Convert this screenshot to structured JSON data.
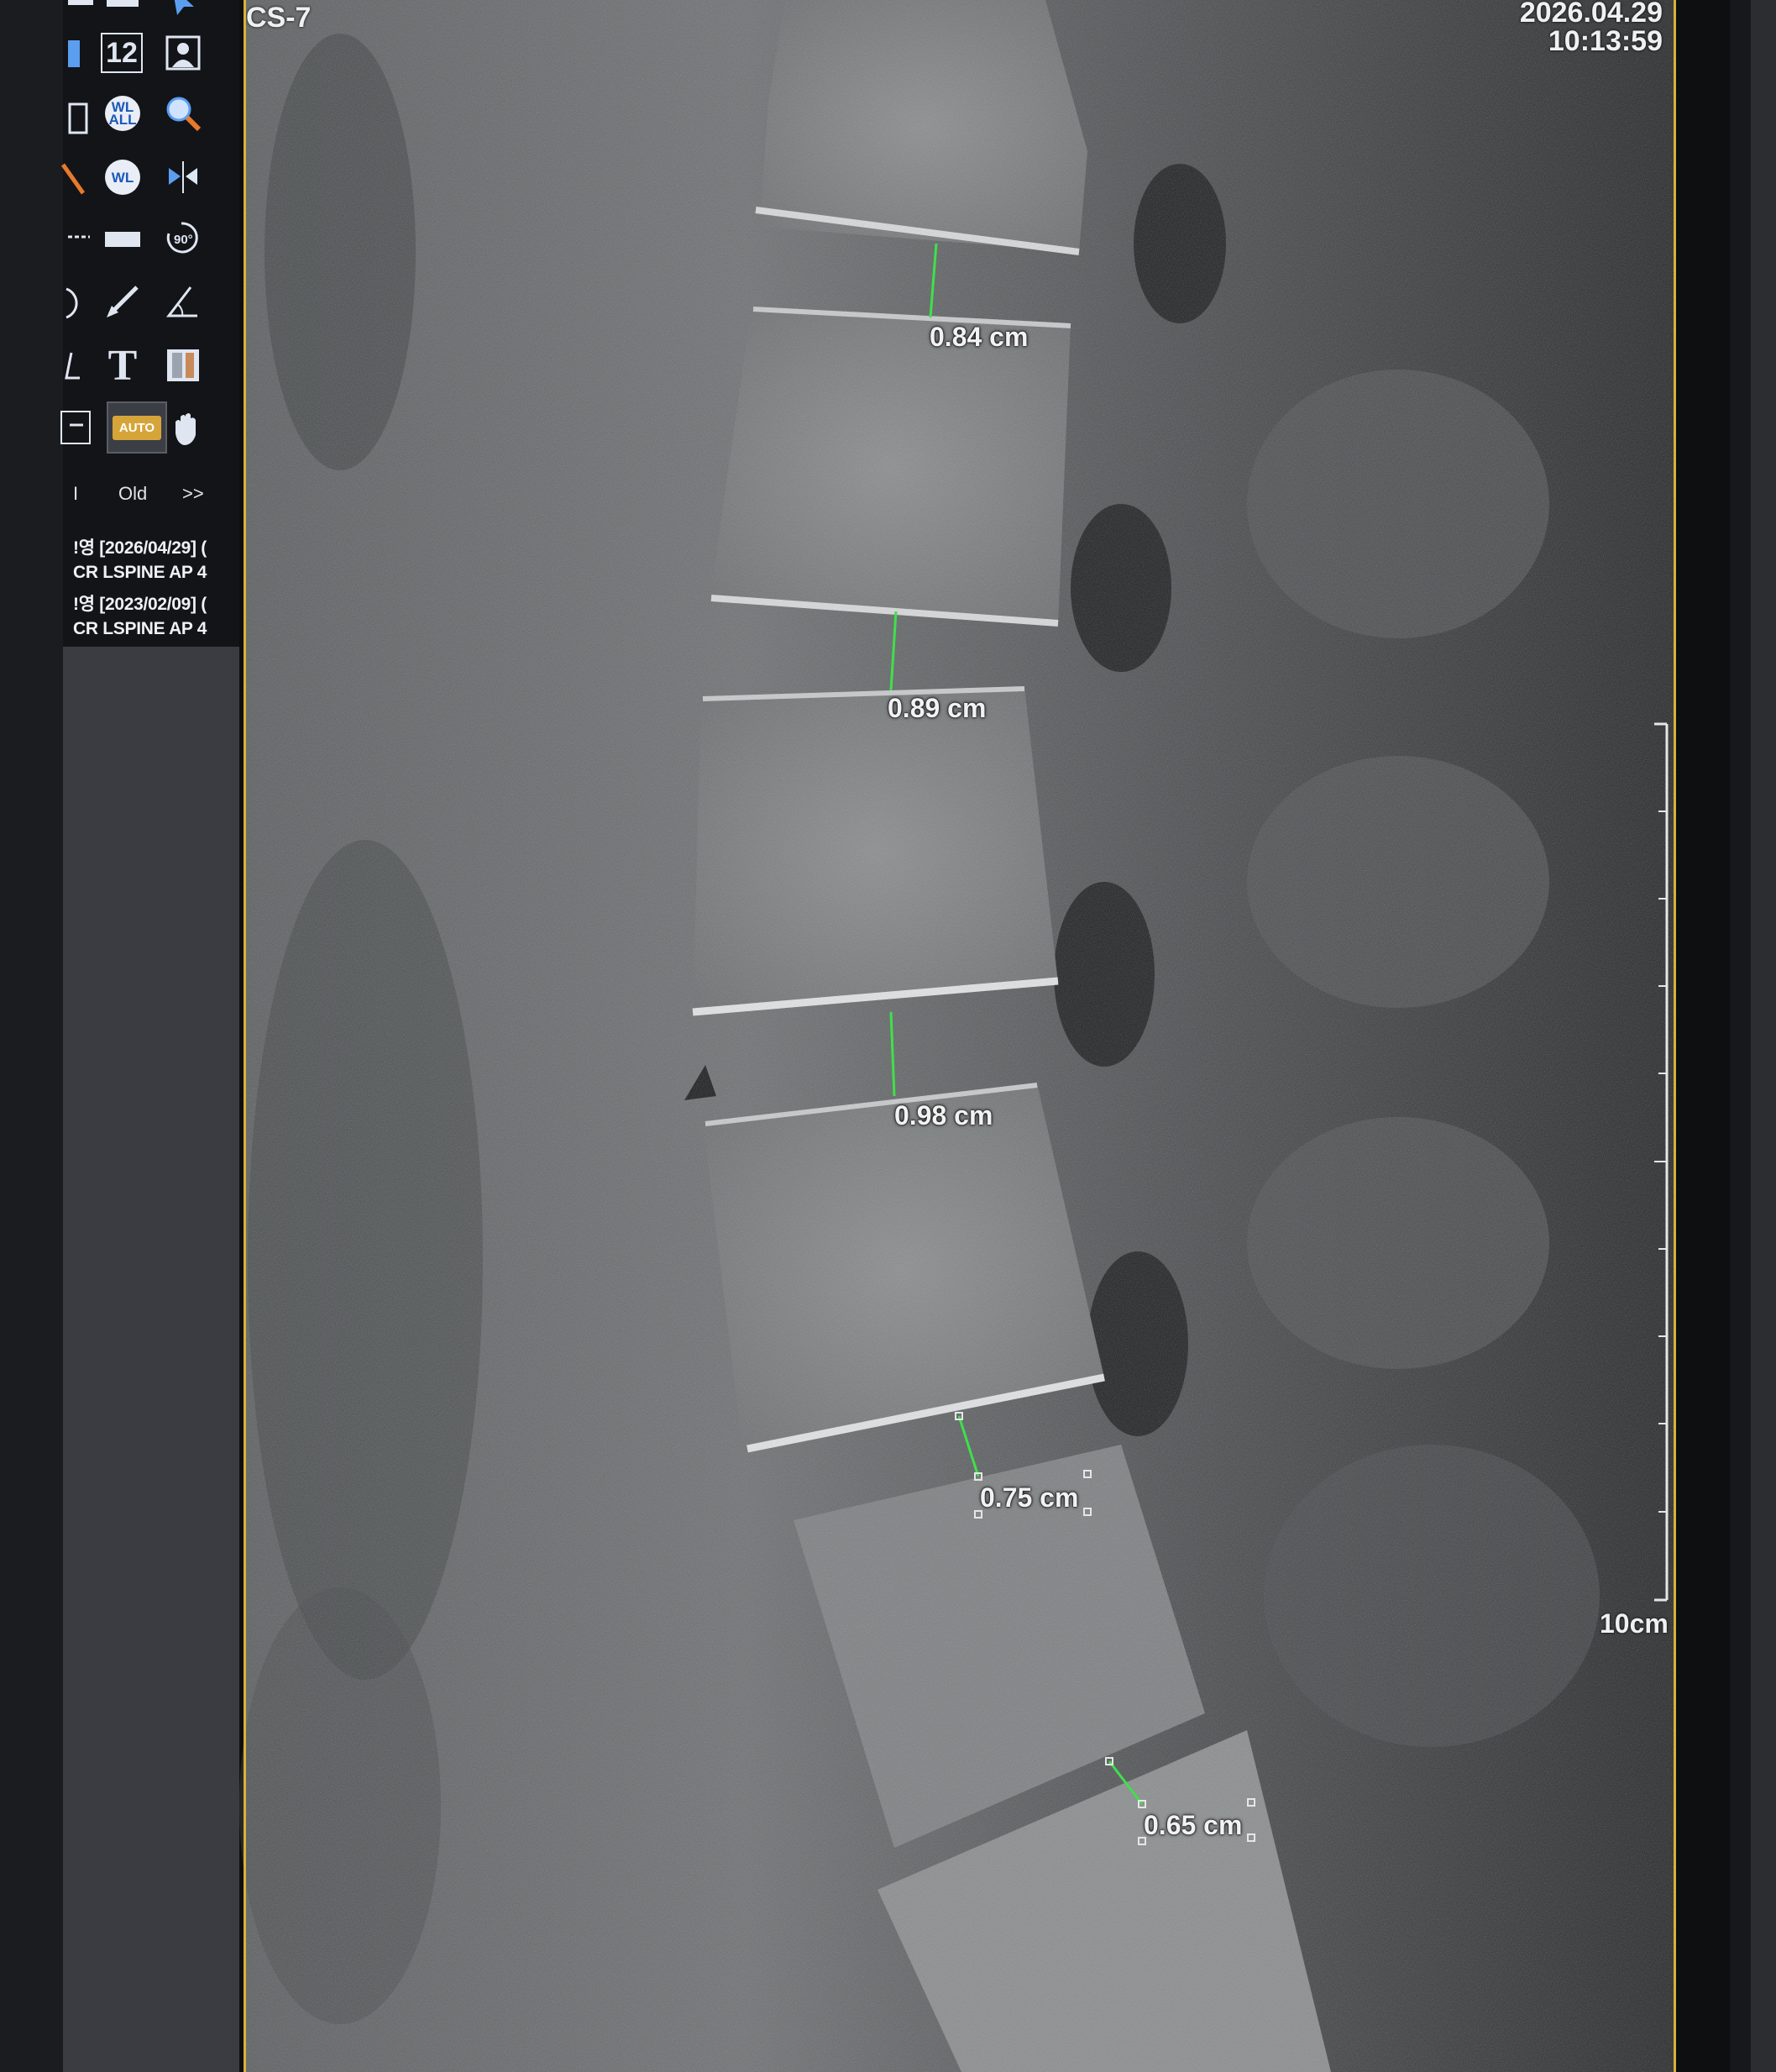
{
  "header": {
    "study_label": "CS-7",
    "date": "2026.04.29",
    "time": "10:13:59"
  },
  "toolbar": {
    "icons": [
      "series-icon",
      "layout-1-2-icon",
      "portrait-icon",
      "hanging-icon",
      "wl-all-icon",
      "zoom-icon",
      "wl-icon",
      "flip-icon",
      "ruler-icon",
      "rotate-90-icon",
      "ellipse-icon",
      "line-measure-icon",
      "angle-icon",
      "text-tool-icon",
      "compare-icon",
      "cursor-icon",
      "auto-icon",
      "pan-hand-icon"
    ],
    "layout_label": "12",
    "wl_all_label_top": "WL",
    "wl_all_label_bottom": "ALL",
    "wl_label": "WL",
    "rotate_label": "90°",
    "text_tool_label": "T",
    "auto_label": "AUTO"
  },
  "study_nav": {
    "old_label": "Old",
    "next_label": ">>",
    "prefix_label": "I"
  },
  "studies": [
    {
      "date_line": "!영 [2026/04/29] (",
      "desc": "CR LSPINE AP 4"
    },
    {
      "date_line": "!영 [2023/02/09] (",
      "desc": "CR LSPINE AP 4"
    }
  ],
  "measurements": [
    {
      "label": "0.84 cm",
      "value": 0.84,
      "unit": "cm"
    },
    {
      "label": "0.89 cm",
      "value": 0.89,
      "unit": "cm"
    },
    {
      "label": "0.98 cm",
      "value": 0.98,
      "unit": "cm"
    },
    {
      "label": "0.75 cm",
      "value": 0.75,
      "unit": "cm"
    },
    {
      "label": "0.65 cm",
      "value": 0.65,
      "unit": "cm"
    }
  ],
  "scale_bar": {
    "label": "10cm"
  },
  "colors": {
    "measure_line": "#3fe04a",
    "frame_border": "#d9b13a",
    "tool_blue": "#5b9ef0",
    "auto_button": "#d6a53a"
  }
}
